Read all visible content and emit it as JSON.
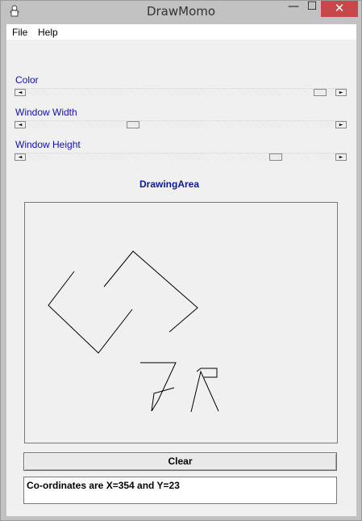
{
  "window": {
    "title": "DrawMomo",
    "icons": {
      "app": "app-icon",
      "minimize": "minimize-icon",
      "maximize": "maximize-icon",
      "close": "close-icon"
    },
    "minimize_glyph": "—",
    "maximize_glyph": "☐",
    "close_glyph": "✕",
    "close_color": "#c7474b"
  },
  "menu": {
    "file": "File",
    "help": "Help"
  },
  "controls": {
    "color": {
      "label": "Color",
      "value_fraction": 0.97
    },
    "width": {
      "label": "Window  Width",
      "value_fraction": 0.34
    },
    "height": {
      "label": "Window  Height",
      "value_fraction": 0.82
    }
  },
  "drawing": {
    "title": "DrawingArea"
  },
  "buttons": {
    "clear": "Clear"
  },
  "status": {
    "coordinates": "Co-ordinates are X=354 and Y=23"
  },
  "colors": {
    "label_text": "#1010c0",
    "drawing_title": "#0a1a9a",
    "stroke": "#000000"
  }
}
